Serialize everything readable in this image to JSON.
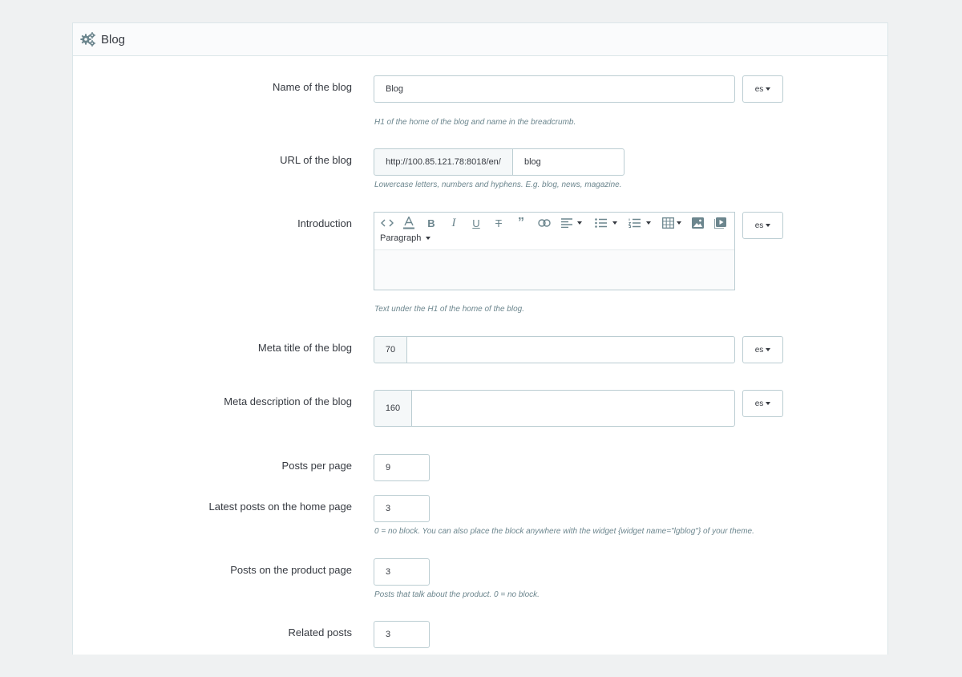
{
  "panel": {
    "title": "Blog",
    "icon": "gears-icon"
  },
  "fields": {
    "name": {
      "label": "Name of the blog",
      "value": "Blog",
      "lang": "es",
      "help": "H1 of the home of the blog and name in the breadcrumb."
    },
    "url": {
      "label": "URL of the blog",
      "prefix": "http://100.85.121.78:8018/en/",
      "value": "blog",
      "help": "Lowercase letters, numbers and hyphens. E.g. blog, news, magazine."
    },
    "intro": {
      "label": "Introduction",
      "format": "Paragraph",
      "lang": "es",
      "help": "Text under the H1 of the home of the blog."
    },
    "meta_title": {
      "label": "Meta title of the blog",
      "counter": "70",
      "value": "",
      "lang": "es"
    },
    "meta_desc": {
      "label": "Meta description of the blog",
      "counter": "160",
      "value": "",
      "lang": "es"
    },
    "posts_per_page": {
      "label": "Posts per page",
      "value": "9"
    },
    "latest_home": {
      "label": "Latest posts on the home page",
      "value": "3",
      "help": "0 = no block. You can also place the block anywhere with the widget {widget name=\"lgblog\"} of your theme."
    },
    "product_posts": {
      "label": "Posts on the product page",
      "value": "3",
      "help": "Posts that talk about the product. 0 = no block."
    },
    "related": {
      "label": "Related posts",
      "value": "3"
    }
  },
  "toolbar_icons": [
    "code-icon",
    "font-color-icon",
    "bold-icon",
    "italic-icon",
    "underline-icon",
    "strikethrough-icon",
    "quote-icon",
    "link-icon",
    "align-icon",
    "bullet-list-icon",
    "numbered-list-icon",
    "table-icon",
    "image-icon",
    "video-icon"
  ],
  "colors": {
    "background": "#eff1f2",
    "border": "#bbcdd2",
    "help_text": "#6c868e",
    "text": "#363a41"
  }
}
